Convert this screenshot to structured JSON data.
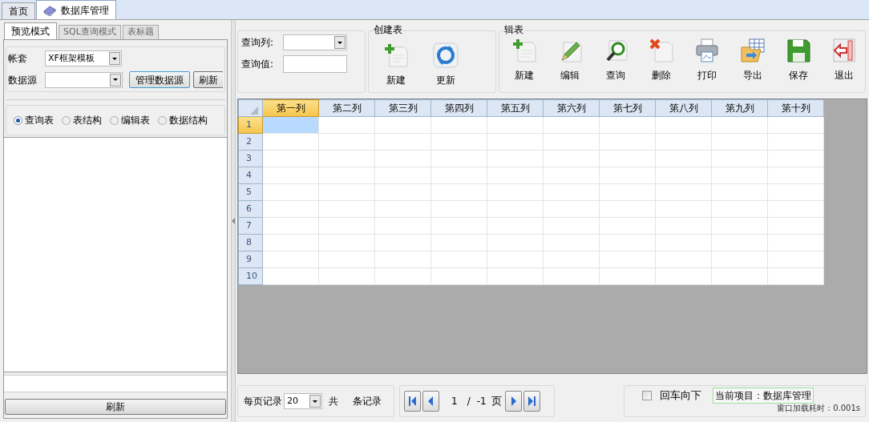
{
  "tabs": [
    {
      "label": "首页",
      "selected": false,
      "has_icon": false
    },
    {
      "label": "数据库管理",
      "selected": true,
      "has_icon": true
    }
  ],
  "left_panel": {
    "subtabs": [
      {
        "label": "预览模式",
        "selected": true
      },
      {
        "label": "SQL查询模式",
        "selected": false
      },
      {
        "label": "表标题",
        "selected": false
      }
    ],
    "account": {
      "label": "帐套",
      "value": "XF框架模板"
    },
    "datasource": {
      "label": "数据源"
    },
    "datasource_buttons": [
      "管理数据源",
      "刷新"
    ],
    "radios": [
      {
        "label": "查询表",
        "selected": true
      },
      {
        "label": "表结构",
        "selected": false
      },
      {
        "label": "编辑表",
        "selected": false
      },
      {
        "label": "数据结构",
        "selected": false
      }
    ],
    "refresh_button": "刷新"
  },
  "query": {
    "column_label": "查询列:",
    "value_label": "查询值:"
  },
  "create_group": {
    "title": "创建表",
    "buttons": [
      {
        "label": "新建",
        "kind": "new"
      },
      {
        "label": "更新",
        "kind": "refresh"
      }
    ]
  },
  "edit_group": {
    "title": "辑表",
    "buttons": [
      {
        "label": "新建",
        "kind": "new"
      },
      {
        "label": "编辑",
        "kind": "edit"
      },
      {
        "label": "查询",
        "kind": "search"
      },
      {
        "label": "删除",
        "kind": "delete"
      },
      {
        "label": "打印",
        "kind": "print"
      },
      {
        "label": "导出",
        "kind": "export"
      },
      {
        "label": "保存",
        "kind": "save"
      },
      {
        "label": "退出",
        "kind": "exit"
      }
    ]
  },
  "table": {
    "columns": [
      {
        "label": "第一列",
        "selected": true
      },
      {
        "label": "第二列",
        "selected": false
      },
      {
        "label": "第三列",
        "selected": false
      },
      {
        "label": "第四列",
        "selected": false
      },
      {
        "label": "第五列",
        "selected": false
      },
      {
        "label": "第六列",
        "selected": false
      },
      {
        "label": "第七列",
        "selected": false
      },
      {
        "label": "第八列",
        "selected": false
      },
      {
        "label": "第九列",
        "selected": false
      },
      {
        "label": "第十列",
        "selected": false
      }
    ],
    "rows": [
      {
        "label": "1",
        "selected": true
      },
      {
        "label": "2",
        "selected": false
      },
      {
        "label": "3",
        "selected": false
      },
      {
        "label": "4",
        "selected": false
      },
      {
        "label": "5",
        "selected": false
      },
      {
        "label": "6",
        "selected": false
      },
      {
        "label": "7",
        "selected": false
      },
      {
        "label": "8",
        "selected": false
      },
      {
        "label": "9",
        "selected": false
      },
      {
        "label": "10",
        "selected": false
      }
    ]
  },
  "pager": {
    "per_page_label": "每页记录",
    "per_page_value": "20",
    "total_prefix": "共",
    "total_suffix": "条记录",
    "page": "1",
    "separator": "/",
    "page_count": "-1",
    "page_suffix": "页"
  },
  "status": {
    "enter_down": {
      "label": "回车向下",
      "checked": false
    },
    "current_project": "当前项目：数据库管理",
    "load_time": "窗口加载耗时：0.001s"
  }
}
